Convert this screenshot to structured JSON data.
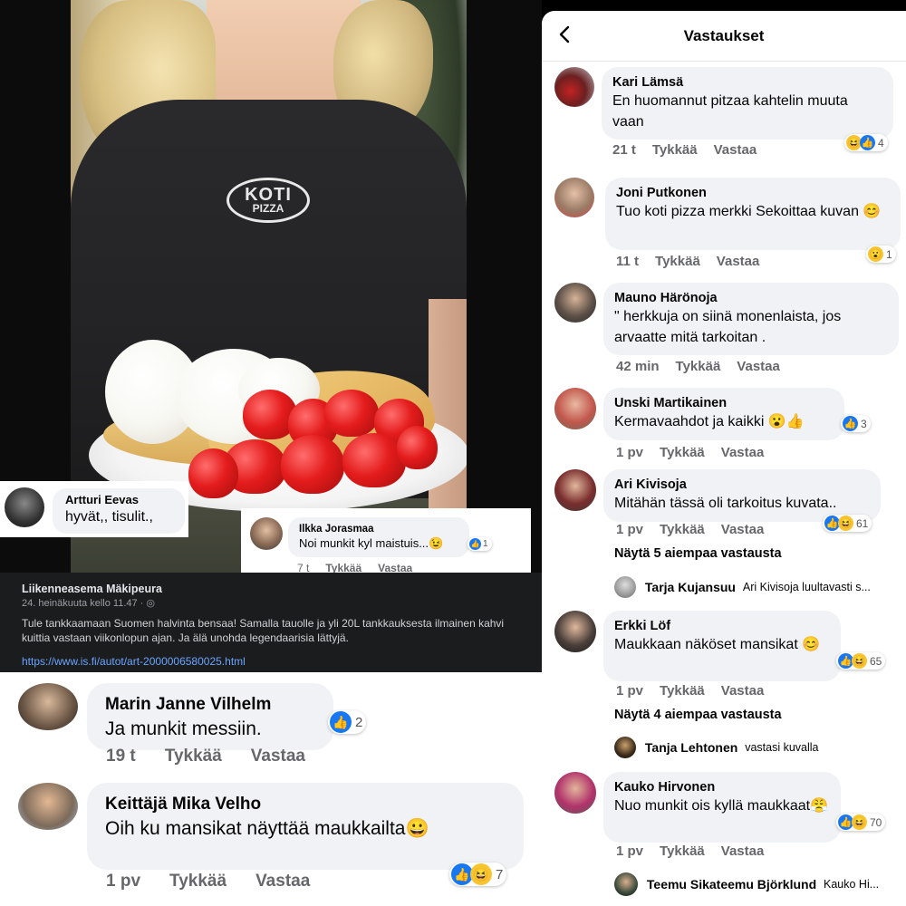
{
  "post": {
    "page_name": "Liikenneasema Mäkipeura",
    "date": "24. heinäkuuta kello 11.47 · ",
    "text": "Tule tankkaamaan Suomen halvinta bensaa! Samalla tauolle ja yli 20L tankkauksesta ilmainen kahvi kuittia vastaan viikonlopun ajan. Ja älä unohda legendaarisia lättyjä.",
    "link": "https://www.is.fi/autot/art-2000006580025.html",
    "shirt_logo": "KOTI",
    "shirt_logo_sub": "PIZZA"
  },
  "overlay_comments": {
    "artturi": {
      "name": "Artturi Eevas",
      "text": "hyvät,, tisulit.,"
    },
    "ilkka": {
      "name": "Ilkka Jorasmaa",
      "text": "Noi munkit kyl maistuis...😉",
      "reactions": "1",
      "time": "7 t",
      "like": "Tykkää",
      "reply": "Vastaa"
    }
  },
  "bottom_comments": [
    {
      "name": "Marin Janne Vilhelm",
      "text": "Ja munkit messiin.",
      "time": "19 t",
      "like": "Tykkää",
      "reply": "Vastaa",
      "reactions": "2"
    },
    {
      "name": "Keittäjä Mika Velho",
      "text": "Oih ku mansikat näyttää maukkailta😀",
      "time": "1 pv",
      "like": "Tykkää",
      "reply": "Vastaa",
      "reactions": "7"
    }
  ],
  "thread": {
    "title": "Vastaukset",
    "comments": [
      {
        "name": "Kari Lämsä",
        "text": "En huomannut pitzaa kahtelin muuta vaan",
        "time": "21 t",
        "like": "Tykkää",
        "reply": "Vastaa",
        "reactions": "4"
      },
      {
        "name": "Joni Putkonen",
        "text": "Tuo koti pizza merkki Sekoittaa kuvan 😊",
        "time": "11 t",
        "like": "Tykkää",
        "reply": "Vastaa",
        "reactions": "1"
      },
      {
        "name": "Mauno Härönoja",
        "text": "\" herkkuja on siinä monenlaista, jos arvaatte mitä tarkoitan .",
        "time": "42 min",
        "like": "Tykkää",
        "reply": "Vastaa"
      },
      {
        "name": "Unski Martikainen",
        "text": "Kermavaahdot ja kaikki 😮👍",
        "time": "1 pv",
        "like": "Tykkää",
        "reply": "Vastaa",
        "reactions": "3"
      },
      {
        "name": "Ari Kivisoja",
        "text": "Mitähän tässä oli tarkoitus kuvata..",
        "time": "1 pv",
        "like": "Tykkää",
        "reply": "Vastaa",
        "reactions": "61"
      },
      {
        "name": "Erkki Löf",
        "text": "Maukkaan näköset mansikat 😊",
        "time": "1 pv",
        "like": "Tykkää",
        "reply": "Vastaa",
        "reactions": "65"
      },
      {
        "name": "Kauko Hirvonen",
        "text": "Nuo munkit ois kyllä maukkaat😤",
        "time": "1 pv",
        "like": "Tykkää",
        "reply": "Vastaa",
        "reactions": "70"
      }
    ],
    "more_1": "Näytä 5 aiempaa vastausta",
    "reply_1": {
      "name": "Tarja Kujansuu",
      "text": "Ari Kivisoja luultavasti s..."
    },
    "more_2": "Näytä 4 aiempaa vastausta",
    "reply_2": {
      "name": "Tanja Lehtonen",
      "text": "vastasi kuvalla"
    },
    "reply_3": {
      "name": "Teemu Sikateemu Björklund",
      "text": "Kauko Hi..."
    }
  },
  "colors": {
    "like_blue": "#1877f2",
    "bubble_gray": "#f0f2f5",
    "meta_gray": "#65676b"
  }
}
